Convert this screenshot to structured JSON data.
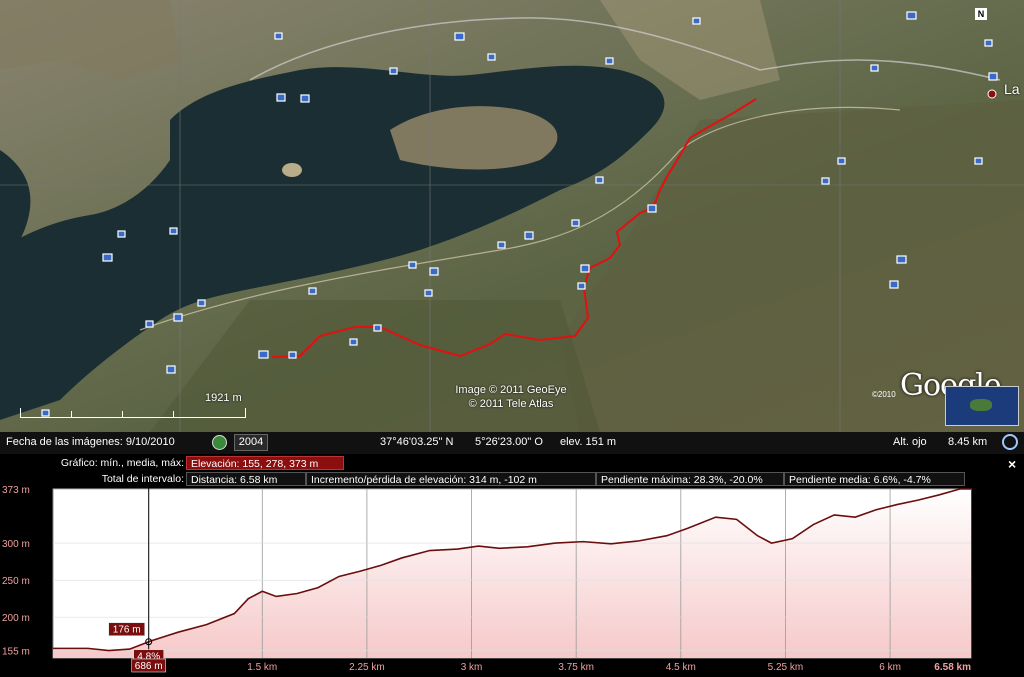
{
  "map": {
    "scale_label": "1921 m",
    "copyright_lines": [
      "Image © 2011 GeoEye",
      "© 2011 Tele Atlas"
    ],
    "google_logo": "Google",
    "google_year": "©2010",
    "north_label": "N",
    "town_label": "La"
  },
  "statusbar": {
    "imagery_date": "Fecha de las imágenes: 9/10/2010",
    "history_year": "2004",
    "latitude": "37°46'03.25\" N",
    "longitude": "5°26'23.00\" O",
    "elevation": "elev.   151 m",
    "eye_alt_label": "Alt. ojo",
    "eye_alt_value": "8.45 km"
  },
  "elevation_panel": {
    "graph_label": "Gráfico: mín., media, máx:",
    "graph_value": "Elevación: 155, 278, 373 m",
    "interval_label": "Total de intervalo:",
    "distance": "Distancia: 6.58 km",
    "gain_loss": "Incremento/pérdida de elevación: 314 m, -102 m",
    "max_slope": "Pendiente máxima: 28.3%, -20.0%",
    "avg_slope": "Pendiente media: 6.6%, -4.7%",
    "close_label": "×",
    "cursor": {
      "elevation_label": "176 m",
      "slope_label": "4.8%",
      "distance_label": "686 m",
      "distance_km": 0.686
    }
  },
  "chart_data": {
    "type": "area",
    "xlabel": "",
    "ylabel": "",
    "x_unit": "km",
    "x_ticks": [
      "1.5 km",
      "2.25 km",
      "3 km",
      "3.75 km",
      "4.5 km",
      "5.25 km",
      "6 km",
      "6.58 km"
    ],
    "x_tick_values": [
      1.5,
      2.25,
      3.0,
      3.75,
      4.5,
      5.25,
      6.0,
      6.58
    ],
    "y_ticks": [
      "373 m",
      "300 m",
      "250 m",
      "200 m",
      "155 m"
    ],
    "y_tick_values": [
      373,
      300,
      250,
      200,
      155
    ],
    "xlim": [
      0,
      6.58
    ],
    "ylim": [
      145,
      373
    ],
    "grid": true,
    "series": [
      {
        "x": [
          0,
          0.25,
          0.4,
          0.55,
          0.7,
          0.9,
          1.1,
          1.3,
          1.4,
          1.5,
          1.6,
          1.75,
          1.9,
          2.05,
          2.2,
          2.35,
          2.5,
          2.7,
          2.9,
          3.05,
          3.2,
          3.4,
          3.6,
          3.8,
          4.0,
          4.2,
          4.4,
          4.55,
          4.75,
          4.9,
          5.05,
          5.15,
          5.3,
          5.45,
          5.6,
          5.75,
          5.9,
          6.05,
          6.2,
          6.35,
          6.5,
          6.58
        ],
        "values": [
          158,
          158,
          155,
          157,
          168,
          180,
          190,
          205,
          225,
          235,
          228,
          232,
          240,
          255,
          262,
          270,
          280,
          290,
          292,
          296,
          293,
          295,
          300,
          302,
          299,
          303,
          310,
          320,
          335,
          332,
          310,
          300,
          306,
          325,
          338,
          335,
          345,
          352,
          358,
          365,
          373,
          373
        ]
      }
    ]
  }
}
